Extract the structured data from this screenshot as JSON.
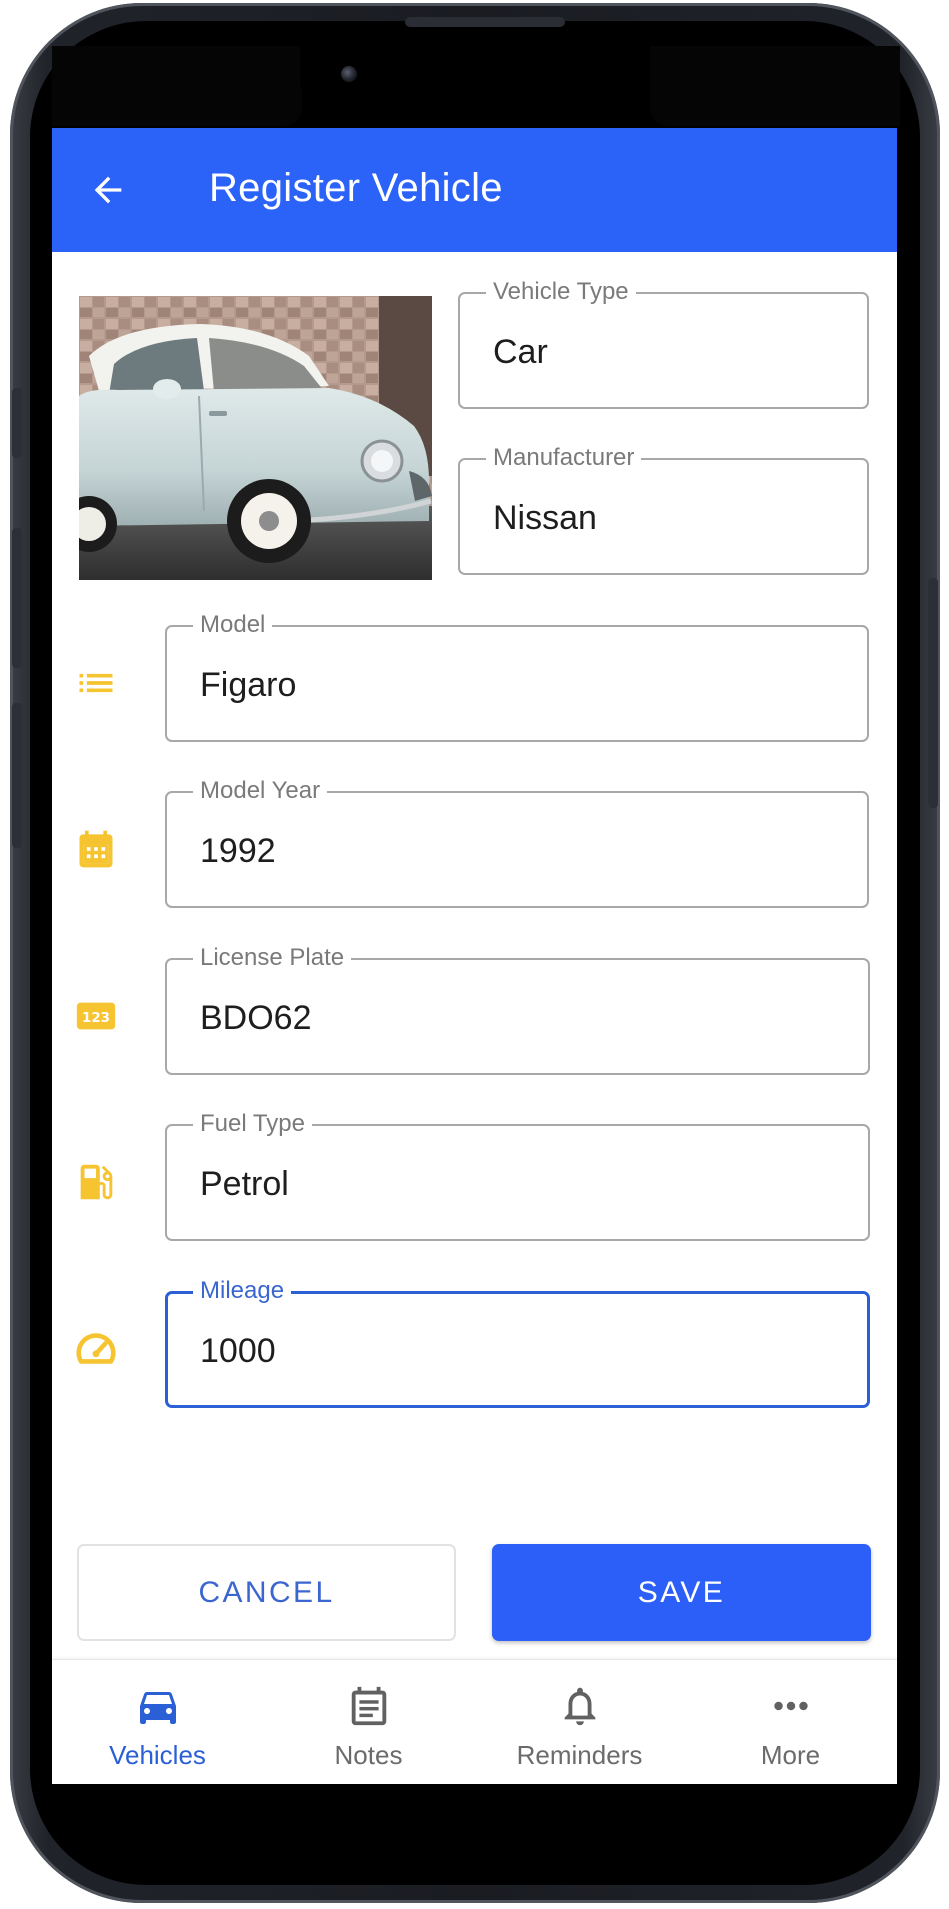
{
  "appbar": {
    "title": "Register Vehicle",
    "back_icon": "arrow-left-icon"
  },
  "colors": {
    "primary": "#2B62F7",
    "icon_accent": "#F6C431",
    "focused_outline": "#2B5FD6",
    "nav_active": "#2B5FD6",
    "nav_inactive": "#6B6B6B"
  },
  "photo": {
    "subject": "car-photo"
  },
  "fields": {
    "vehicle_type": {
      "label": "Vehicle Type",
      "value": "Car"
    },
    "manufacturer": {
      "label": "Manufacturer",
      "value": "Nissan"
    },
    "model": {
      "label": "Model",
      "value": "Figaro",
      "icon": "list-icon"
    },
    "model_year": {
      "label": "Model Year",
      "value": "1992",
      "icon": "calendar-icon"
    },
    "license_plate": {
      "label": "License Plate",
      "value": "BDO62",
      "icon": "numeric-123-icon"
    },
    "fuel_type": {
      "label": "Fuel Type",
      "value": "Petrol",
      "icon": "fuel-pump-icon"
    },
    "mileage": {
      "label": "Mileage",
      "value": "1000",
      "icon": "speedometer-icon",
      "focused": true
    }
  },
  "actions": {
    "cancel_label": "CANCEL",
    "save_label": "SAVE"
  },
  "bottom_nav": {
    "items": [
      {
        "label": "Vehicles",
        "icon": "car-icon",
        "active": true
      },
      {
        "label": "Notes",
        "icon": "notes-icon",
        "active": false
      },
      {
        "label": "Reminders",
        "icon": "bell-icon",
        "active": false
      },
      {
        "label": "More",
        "icon": "more-dots-icon",
        "active": false
      }
    ]
  }
}
